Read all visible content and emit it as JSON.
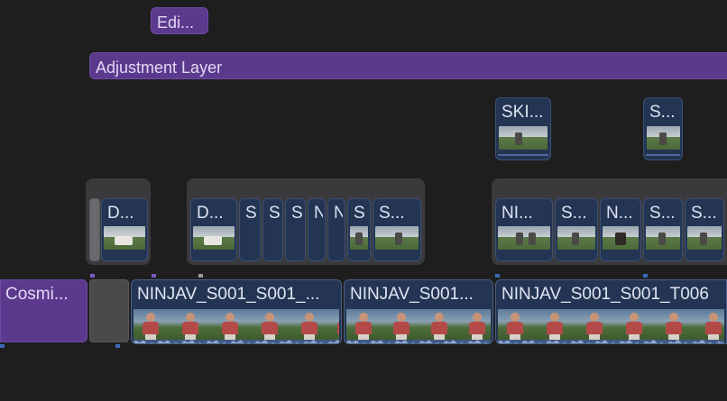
{
  "timeline": {
    "title_clip": {
      "label": "Edi..."
    },
    "adjustment_layer": {
      "label": "Adjustment Layer"
    },
    "connected_top": [
      {
        "label": "SKI..."
      },
      {
        "label": "S..."
      }
    ],
    "group_a": [
      {
        "label": "D..."
      }
    ],
    "group_b": [
      {
        "label": "D..."
      },
      {
        "label": "S"
      },
      {
        "label": "S"
      },
      {
        "label": "S"
      },
      {
        "label": "N"
      },
      {
        "label": "N"
      },
      {
        "label": "S"
      },
      {
        "label": "S..."
      }
    ],
    "group_c": [
      {
        "label": "NI..."
      },
      {
        "label": "S..."
      },
      {
        "label": "N..."
      },
      {
        "label": "S..."
      },
      {
        "label": "S..."
      }
    ],
    "primary": [
      {
        "label": "Cosmi..."
      },
      {
        "label": "NINJAV_S001_S001_..."
      },
      {
        "label": "NINJAV_S001..."
      },
      {
        "label": "NINJAV_S001_S001_T006"
      }
    ]
  },
  "colors": {
    "background": "#1e1e1f",
    "title_purple": "#5b3a8d",
    "video_blue": "#243553",
    "group_gray": "#3a3a3c"
  }
}
